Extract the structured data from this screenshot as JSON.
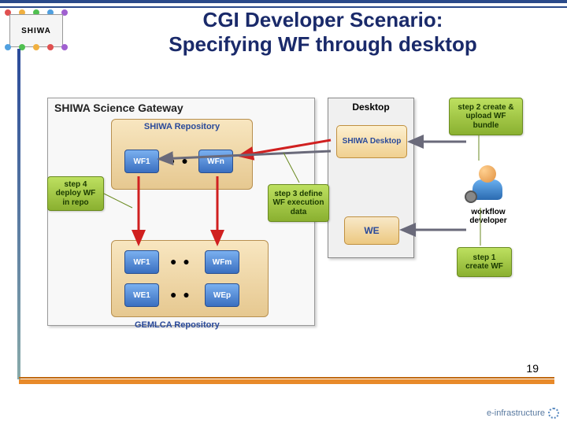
{
  "title_line1": "CGI Developer Scenario:",
  "title_line2": "Specifying WF through desktop",
  "logo_text": "SHIWA",
  "gateway": {
    "title": "SHIWA Science Gateway",
    "shiwa_repo": {
      "label": "SHIWA Repository",
      "wf1": "WF1",
      "wfn": "WFn"
    },
    "gemlca_repo": {
      "label": "GEMLCA Repository",
      "row1": {
        "a": "WF1",
        "b": "WFm"
      },
      "row2": {
        "a": "WE1",
        "b": "WEp"
      }
    }
  },
  "desktop": {
    "title": "Desktop",
    "shiwa_desktop": "SHIWA Desktop",
    "we": "WE"
  },
  "developer_label": "workflow developer",
  "steps": {
    "s1": "step 1 create WF",
    "s2": "step 2 create & upload WF bundle",
    "s3": "step 3 define WF execution data",
    "s4": "step 4 deploy WF in repo"
  },
  "page_number": "19",
  "footer_brand": "e-infrastructure",
  "colors": {
    "title": "#1a2a6a",
    "accent_orange": "#e88a2a",
    "step_green": "#9cc83a",
    "repo_tan": "#ecd298",
    "wf_blue": "#4a80cc",
    "arrow_red": "#d02020",
    "arrow_gray": "#6a6a7a"
  }
}
